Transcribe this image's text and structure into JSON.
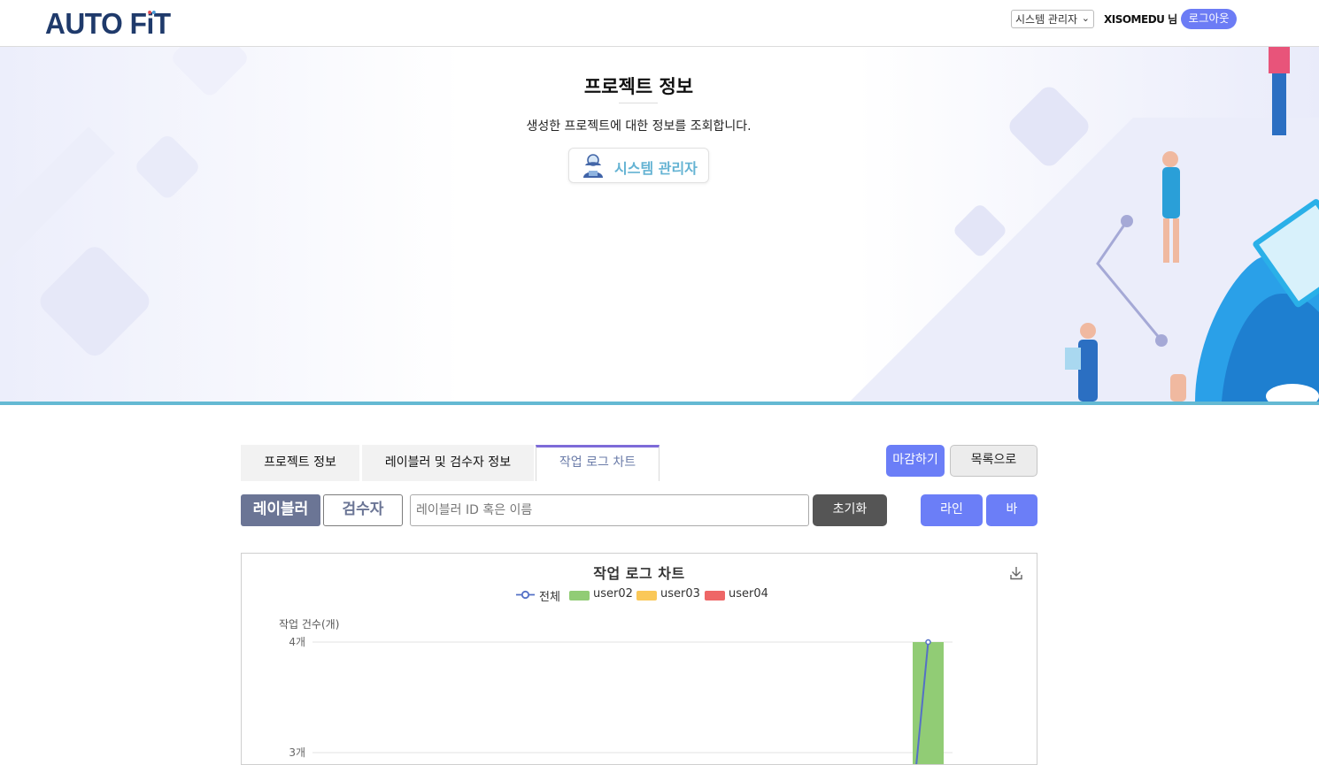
{
  "header": {
    "logo": "AUTO FiT",
    "role_select": "시스템 관리자",
    "user_name": "XISOMEDU 님",
    "logout_label": "로그아웃"
  },
  "banner": {
    "title": "프로젝트 정보",
    "description": "생성한 프로젝트에 대한 정보를 조회합니다.",
    "role_badge": "시스템 관리자"
  },
  "tabs": [
    {
      "label": "프로젝트 정보",
      "active": false
    },
    {
      "label": "레이블러 및 검수자 정보",
      "active": false
    },
    {
      "label": "작업 로그 차트",
      "active": true
    }
  ],
  "actions": {
    "close_label": "마감하기",
    "list_label": "목록으로"
  },
  "filter": {
    "labeler_label": "레이블러",
    "reviewer_label": "검수자",
    "search_placeholder": "레이블러 ID 혹은 이름",
    "search_value": "",
    "reset_label": "초기화",
    "line_label": "라인",
    "bar_label": "바"
  },
  "colors": {
    "accent": "#6b7ef7",
    "banner_line": "#64b9d3",
    "tab_active_border": "#7d6bd8"
  },
  "chart_data": {
    "type": "bar",
    "title": "작업 로그 차트",
    "ylabel": "작업 건수(개)",
    "ylim": [
      3,
      4
    ],
    "y_ticks": [
      "4개",
      "3개"
    ],
    "y_tick_values": [
      4,
      3
    ],
    "legend": [
      {
        "name": "전체",
        "kind": "line",
        "color": "#5470c6"
      },
      {
        "name": "user02",
        "kind": "bar",
        "color": "#91cc75"
      },
      {
        "name": "user03",
        "kind": "bar",
        "color": "#fac858"
      },
      {
        "name": "user04",
        "kind": "bar",
        "color": "#ee6666"
      }
    ],
    "series": [
      {
        "name": "user02",
        "type": "bar",
        "values_visible": [
          4
        ]
      },
      {
        "name": "전체",
        "type": "line",
        "values_visible": [
          4
        ]
      }
    ],
    "grid": true,
    "legend_position": "top-center"
  }
}
